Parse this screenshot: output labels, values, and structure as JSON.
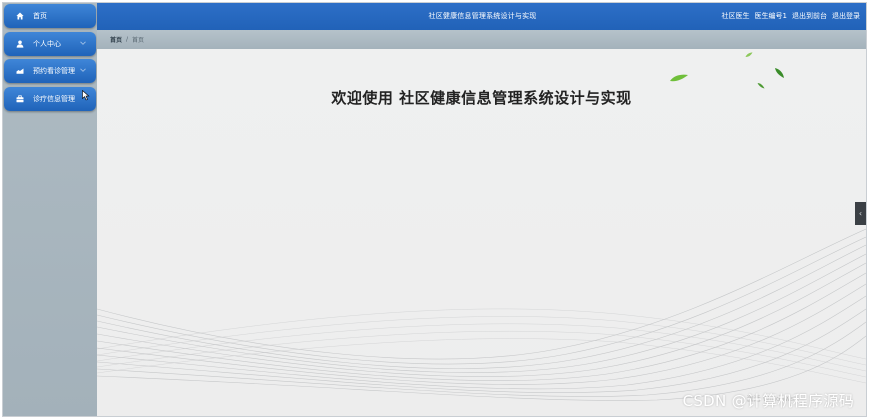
{
  "header": {
    "title": "社区健康信息管理系统设计与实现",
    "user_role": "社区医生",
    "user_name": "医生编号1",
    "back_to_front_label": "退出到前台",
    "logout_label": "退出登录"
  },
  "sidebar": {
    "items": [
      {
        "label": "首页",
        "icon": "home-icon"
      },
      {
        "label": "个人中心",
        "icon": "user-icon",
        "has_chevron": true
      },
      {
        "label": "预约看诊管理",
        "icon": "appointment-icon",
        "has_chevron": true
      },
      {
        "label": "诊疗信息管理",
        "icon": "briefcase-icon"
      }
    ]
  },
  "breadcrumb": {
    "home_label": "首页",
    "separator": "/",
    "current_label": "首页"
  },
  "main": {
    "welcome_text": "欢迎使用 社区健康信息管理系统设计与实现"
  },
  "overlay": {
    "activate_windows_text": "激活 Windows",
    "watermark": "CSDN @计算机程序源码"
  },
  "colors": {
    "header_blue": "#2162b8",
    "menu_blue": "#2a6fc8",
    "sidebar_gray": "#a8b6bf",
    "content_bg": "#eeeeee"
  }
}
